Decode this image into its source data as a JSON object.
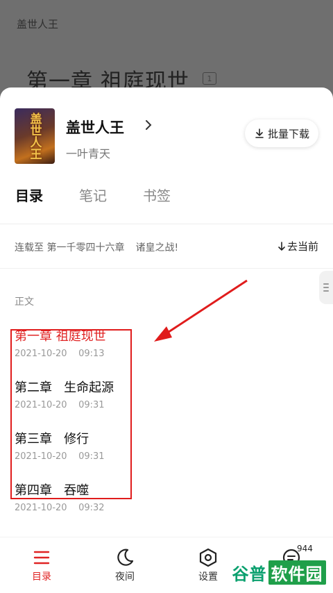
{
  "reader": {
    "book_name": "盖世人王",
    "chapter_heading": "第一章 祖庭现世",
    "chapter_index": "1"
  },
  "sheet": {
    "cover_title": "盖世人王",
    "book_title": "盖世人王",
    "author": "一叶青天",
    "batch_download_label": "批量下载"
  },
  "tabs": [
    {
      "label": "目录"
    },
    {
      "label": "笔记"
    },
    {
      "label": "书签"
    }
  ],
  "serial": {
    "prefix": "连载至",
    "latest_chapter": "第一千零四十六章",
    "latest_title": "诸皇之战!",
    "goto_current": "去当前"
  },
  "section_label": "正文",
  "chapters": [
    {
      "name": "第一章 祖庭现世",
      "date": "2021-10-20    09:13"
    },
    {
      "name": "第二章   生命起源",
      "date": "2021-10-20    09:31"
    },
    {
      "name": "第三章   修行",
      "date": "2021-10-20    09:31"
    },
    {
      "name": "第四章   吞噬",
      "date": "2021-10-20    09:32"
    }
  ],
  "bottom_nav": [
    {
      "label": "目录",
      "icon": "menu-icon"
    },
    {
      "label": "夜间",
      "icon": "moon-icon"
    },
    {
      "label": "设置",
      "icon": "settings-icon"
    },
    {
      "label": "",
      "icon": "comment-icon"
    }
  ],
  "comment_count": "944",
  "watermark": {
    "part1": "谷普",
    "part2": "软件园"
  },
  "colors": {
    "accent": "#e02424",
    "annotation": "#e01c1c"
  }
}
